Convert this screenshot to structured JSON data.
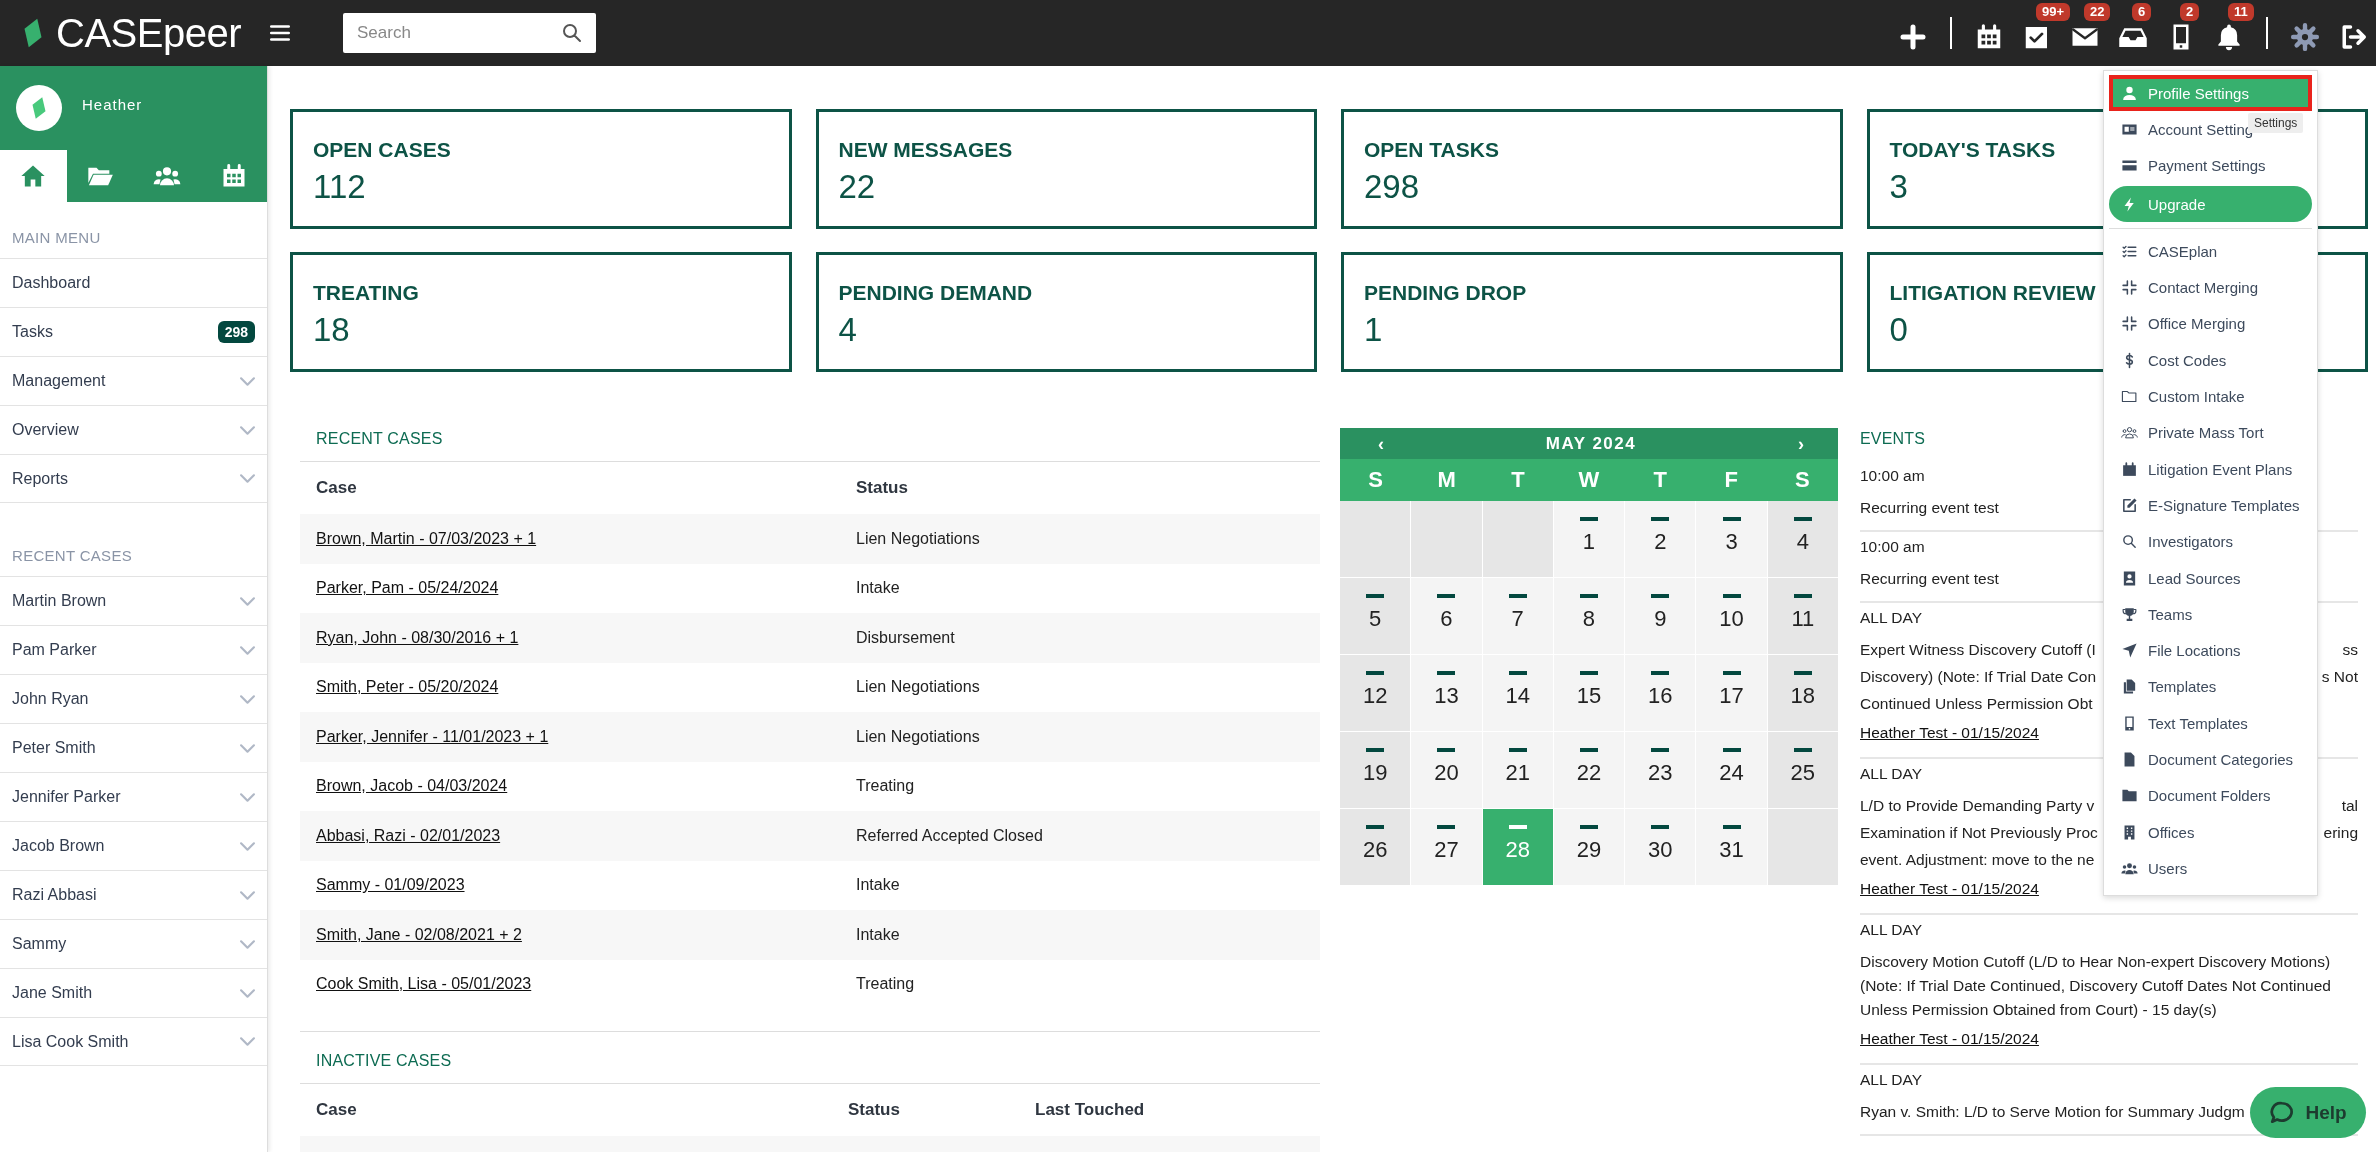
{
  "topbar": {
    "brand": "CASEpeer",
    "search": {
      "placeholder": "Search"
    },
    "actions": [
      {
        "selected": false
      },
      {
        "selected": false
      },
      {
        "selected": false,
        "badge": "99+"
      },
      {
        "selected": false,
        "badge": "22"
      },
      {
        "selected": false,
        "badge": "6"
      },
      {
        "selected": false,
        "badge": "2"
      },
      {
        "selected": false,
        "badge": "11"
      },
      {
        "selected": true
      },
      {
        "selected": false
      }
    ]
  },
  "sidebar": {
    "user": "Heather",
    "tabs": [
      {
        "selected": true
      },
      {
        "selected": false
      },
      {
        "selected": false
      },
      {
        "selected": false
      }
    ],
    "main_menu": {
      "heading": "MAIN MENU",
      "items": [
        {
          "label": "Dashboard",
          "expandable": false
        },
        {
          "label": "Tasks",
          "badge": "298",
          "expandable": false
        },
        {
          "label": "Management",
          "expandable": true
        },
        {
          "label": "Overview",
          "expandable": true
        },
        {
          "label": "Reports",
          "expandable": true
        }
      ]
    },
    "recent_cases": {
      "heading": "RECENT CASES",
      "items": [
        {
          "label": "Martin Brown",
          "expandable": true
        },
        {
          "label": "Pam Parker",
          "expandable": true
        },
        {
          "label": "John Ryan",
          "expandable": true
        },
        {
          "label": "Peter Smith",
          "expandable": true
        },
        {
          "label": "Jennifer Parker",
          "expandable": true
        },
        {
          "label": "Jacob Brown",
          "expandable": true
        },
        {
          "label": "Razi Abbasi",
          "expandable": true
        },
        {
          "label": "Sammy",
          "expandable": true
        },
        {
          "label": "Jane Smith",
          "expandable": true
        },
        {
          "label": "Lisa Cook Smith",
          "expandable": true
        }
      ]
    }
  },
  "stats": [
    {
      "label": "OPEN CASES",
      "value": "112"
    },
    {
      "label": "NEW MESSAGES",
      "value": "22"
    },
    {
      "label": "OPEN TASKS",
      "value": "298"
    },
    {
      "label": "TODAY'S TASKS",
      "value": "3"
    },
    {
      "label": "TREATING",
      "value": "18"
    },
    {
      "label": "PENDING DEMAND",
      "value": "4"
    },
    {
      "label": "PENDING DROP",
      "value": "1"
    },
    {
      "label": "LITIGATION REVIEW",
      "value": "0"
    }
  ],
  "recent_cases": {
    "title": "RECENT CASES",
    "columns": [
      "Case",
      "Status"
    ],
    "rows": [
      {
        "case": "Brown, Martin - 07/03/2023 + 1",
        "status": "Lien Negotiations"
      },
      {
        "case": "Parker, Pam - 05/24/2024",
        "status": "Intake"
      },
      {
        "case": "Ryan, John - 08/30/2016 + 1",
        "status": "Disbursement"
      },
      {
        "case": "Smith, Peter - 05/20/2024",
        "status": "Lien Negotiations"
      },
      {
        "case": "Parker, Jennifer - 11/01/2023 + 1",
        "status": "Lien Negotiations"
      },
      {
        "case": "Brown, Jacob - 04/03/2024",
        "status": "Treating"
      },
      {
        "case": "Abbasi, Razi - 02/01/2023",
        "status": "Referred Accepted Closed"
      },
      {
        "case": "Sammy - 01/09/2023",
        "status": "Intake"
      },
      {
        "case": "Smith, Jane - 02/08/2021 + 2",
        "status": "Intake"
      },
      {
        "case": "Cook Smith, Lisa - 05/01/2023",
        "status": "Treating"
      }
    ]
  },
  "inactive_cases": {
    "title": "INACTIVE CASES",
    "columns": [
      "Case",
      "Status",
      "Last Touched"
    ]
  },
  "calendar": {
    "title": "MAY 2024",
    "prev": "‹",
    "next": "›",
    "weekdays": [
      "S",
      "M",
      "T",
      "W",
      "T",
      "F",
      "S"
    ],
    "cells": [
      {
        "kind": "blank"
      },
      {
        "kind": "blank"
      },
      {
        "kind": "blank"
      },
      {
        "kind": "day",
        "label": "1",
        "selected": false,
        "has_event": true
      },
      {
        "kind": "day",
        "label": "2",
        "selected": false,
        "has_event": true
      },
      {
        "kind": "day",
        "label": "3",
        "selected": false,
        "has_event": true
      },
      {
        "kind": "day",
        "label": "4",
        "selected": false,
        "has_event": true
      },
      {
        "kind": "day",
        "label": "5",
        "selected": false,
        "has_event": true
      },
      {
        "kind": "day",
        "label": "6",
        "selected": false,
        "has_event": true
      },
      {
        "kind": "day",
        "label": "7",
        "selected": false,
        "has_event": true
      },
      {
        "kind": "day",
        "label": "8",
        "selected": false,
        "has_event": true
      },
      {
        "kind": "day",
        "label": "9",
        "selected": false,
        "has_event": true
      },
      {
        "kind": "day",
        "label": "10",
        "selected": false,
        "has_event": true
      },
      {
        "kind": "day",
        "label": "11",
        "selected": false,
        "has_event": true
      },
      {
        "kind": "day",
        "label": "12",
        "selected": false,
        "has_event": true
      },
      {
        "kind": "day",
        "label": "13",
        "selected": false,
        "has_event": true
      },
      {
        "kind": "day",
        "label": "14",
        "selected": false,
        "has_event": true
      },
      {
        "kind": "day",
        "label": "15",
        "selected": false,
        "has_event": true
      },
      {
        "kind": "day",
        "label": "16",
        "selected": false,
        "has_event": true
      },
      {
        "kind": "day",
        "label": "17",
        "selected": false,
        "has_event": true
      },
      {
        "kind": "day",
        "label": "18",
        "selected": false,
        "has_event": true
      },
      {
        "kind": "day",
        "label": "19",
        "selected": false,
        "has_event": true
      },
      {
        "kind": "day",
        "label": "20",
        "selected": false,
        "has_event": true
      },
      {
        "kind": "day",
        "label": "21",
        "selected": false,
        "has_event": true
      },
      {
        "kind": "day",
        "label": "22",
        "selected": false,
        "has_event": true
      },
      {
        "kind": "day",
        "label": "23",
        "selected": false,
        "has_event": true
      },
      {
        "kind": "day",
        "label": "24",
        "selected": false,
        "has_event": true
      },
      {
        "kind": "day",
        "label": "25",
        "selected": false,
        "has_event": true
      },
      {
        "kind": "day",
        "label": "26",
        "selected": false,
        "has_event": true
      },
      {
        "kind": "day",
        "label": "27",
        "selected": false,
        "has_event": true
      },
      {
        "kind": "day",
        "label": "28",
        "selected": true,
        "has_event": true
      },
      {
        "kind": "day",
        "label": "29",
        "selected": false,
        "has_event": true
      },
      {
        "kind": "day",
        "label": "30",
        "selected": false,
        "has_event": true
      },
      {
        "kind": "day",
        "label": "31",
        "selected": false,
        "has_event": true
      },
      {
        "kind": "blank"
      }
    ]
  },
  "events": {
    "title": "EVENTS",
    "items": [
      {
        "time": "10:00 am",
        "lines": [
          {
            "left": "Recurring event test"
          }
        ]
      },
      {
        "time": "10:00 am",
        "lines": [
          {
            "left": "Recurring event test"
          }
        ]
      },
      {
        "time": "ALL DAY",
        "lines": [
          {
            "left": "Expert Witness Discovery Cutoff (I",
            "right": "ss"
          },
          {
            "left": "Discovery) (Note: If Trial Date Con",
            "right": "s Not"
          },
          {
            "left": "Continued Unless Permission Obt"
          }
        ],
        "link": "Heather Test - 01/15/2024"
      },
      {
        "time": "ALL DAY",
        "lines": [
          {
            "left": "L/D to Provide Demanding Party v",
            "right": "tal"
          },
          {
            "left": "Examination if Not Previously Proc",
            "right": "ering"
          },
          {
            "left": "event. Adjustment: move to the ne"
          }
        ],
        "link": "Heather Test - 01/15/2024"
      },
      {
        "time": "ALL DAY",
        "lines": [
          {
            "left": "Discovery Motion Cutoff (L/D to Hear Non-expert Discovery Motions) (Note: If Trial Date Continued, Discovery Cutoff Dates Not Continued Unless Permission Obtained from Court) - 15 day(s)"
          }
        ],
        "link": "Heather Test - 01/15/2024"
      },
      {
        "time": "ALL DAY",
        "lines": [
          {
            "left": "Ryan v. Smith: L/D to Serve Motion for Summary Judgm"
          }
        ]
      }
    ]
  },
  "settings_menu": {
    "tooltip": "Settings",
    "groups": [
      [
        {
          "kind": "item",
          "label": "Profile Settings",
          "selected": true
        },
        {
          "kind": "item",
          "label": "Account Setting",
          "selected": false
        },
        {
          "kind": "item",
          "label": "Payment Settings",
          "selected": false
        },
        {
          "kind": "button",
          "label": "Upgrade",
          "selected": false
        }
      ],
      [
        {
          "kind": "item",
          "label": "CASEplan",
          "selected": false
        },
        {
          "kind": "item",
          "label": "Contact Merging",
          "selected": false
        },
        {
          "kind": "item",
          "label": "Office Merging",
          "selected": false
        },
        {
          "kind": "item",
          "label": "Cost Codes",
          "selected": false
        },
        {
          "kind": "item",
          "label": "Custom Intake",
          "selected": false
        },
        {
          "kind": "item",
          "label": "Private Mass Tort",
          "selected": false
        },
        {
          "kind": "item",
          "label": "Litigation Event Plans",
          "selected": false
        },
        {
          "kind": "item",
          "label": "E-Signature Templates",
          "selected": false
        },
        {
          "kind": "item",
          "label": "Investigators",
          "selected": false
        },
        {
          "kind": "item",
          "label": "Lead Sources",
          "selected": false
        },
        {
          "kind": "item",
          "label": "Teams",
          "selected": false
        },
        {
          "kind": "item",
          "label": "File Locations",
          "selected": false
        },
        {
          "kind": "item",
          "label": "Templates",
          "selected": false
        },
        {
          "kind": "item",
          "label": "Text Templates",
          "selected": false
        },
        {
          "kind": "item",
          "label": "Document Categories",
          "selected": false
        },
        {
          "kind": "item",
          "label": "Document Folders",
          "selected": false
        },
        {
          "kind": "item",
          "label": "Offices",
          "selected": false
        },
        {
          "kind": "item",
          "label": "Users",
          "selected": false
        }
      ]
    ]
  },
  "help": {
    "label": "Help"
  }
}
